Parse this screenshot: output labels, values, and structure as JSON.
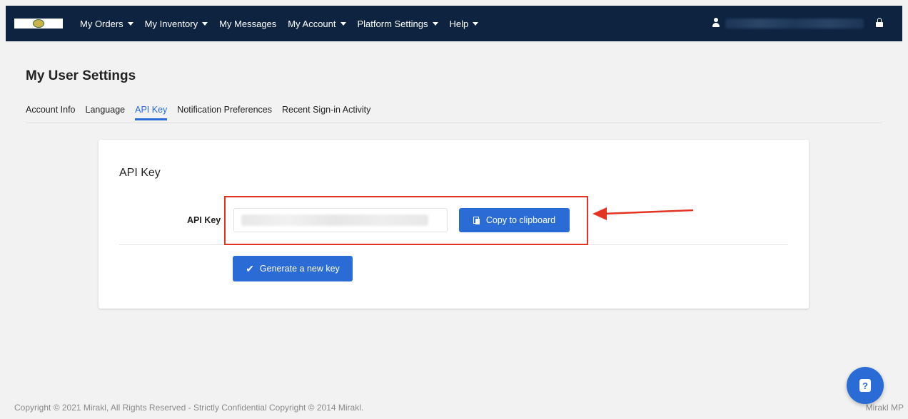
{
  "nav": {
    "items": [
      {
        "label": "My Orders",
        "has_caret": true
      },
      {
        "label": "My Inventory",
        "has_caret": true
      },
      {
        "label": "My Messages",
        "has_caret": false
      },
      {
        "label": "My Account",
        "has_caret": true
      },
      {
        "label": "Platform Settings",
        "has_caret": true
      },
      {
        "label": "Help",
        "has_caret": true
      }
    ],
    "icons": {
      "user": "user-icon",
      "lock": "lock-icon",
      "logo": "logo-seal"
    }
  },
  "page": {
    "title": "My User Settings",
    "tabs": [
      {
        "label": "Account Info",
        "active": false
      },
      {
        "label": "Language",
        "active": false
      },
      {
        "label": "API Key",
        "active": true
      },
      {
        "label": "Notification Preferences",
        "active": false
      },
      {
        "label": "Recent Sign-in Activity",
        "active": false
      }
    ]
  },
  "card": {
    "title": "API Key",
    "field_label": "API Key",
    "copy_button": "Copy to clipboard",
    "generate_button": "Generate a new key"
  },
  "footer": {
    "copyright": "Copyright © 2021 Mirakl, All Rights Reserved - Strictly Confidential Copyright © 2014 Mirakl.",
    "right_label": "Mirakl MP"
  },
  "colors": {
    "topbar": "#0d2340",
    "accent": "#2a6bd6",
    "annotation": "#e33322",
    "background": "#f2f2f2"
  }
}
